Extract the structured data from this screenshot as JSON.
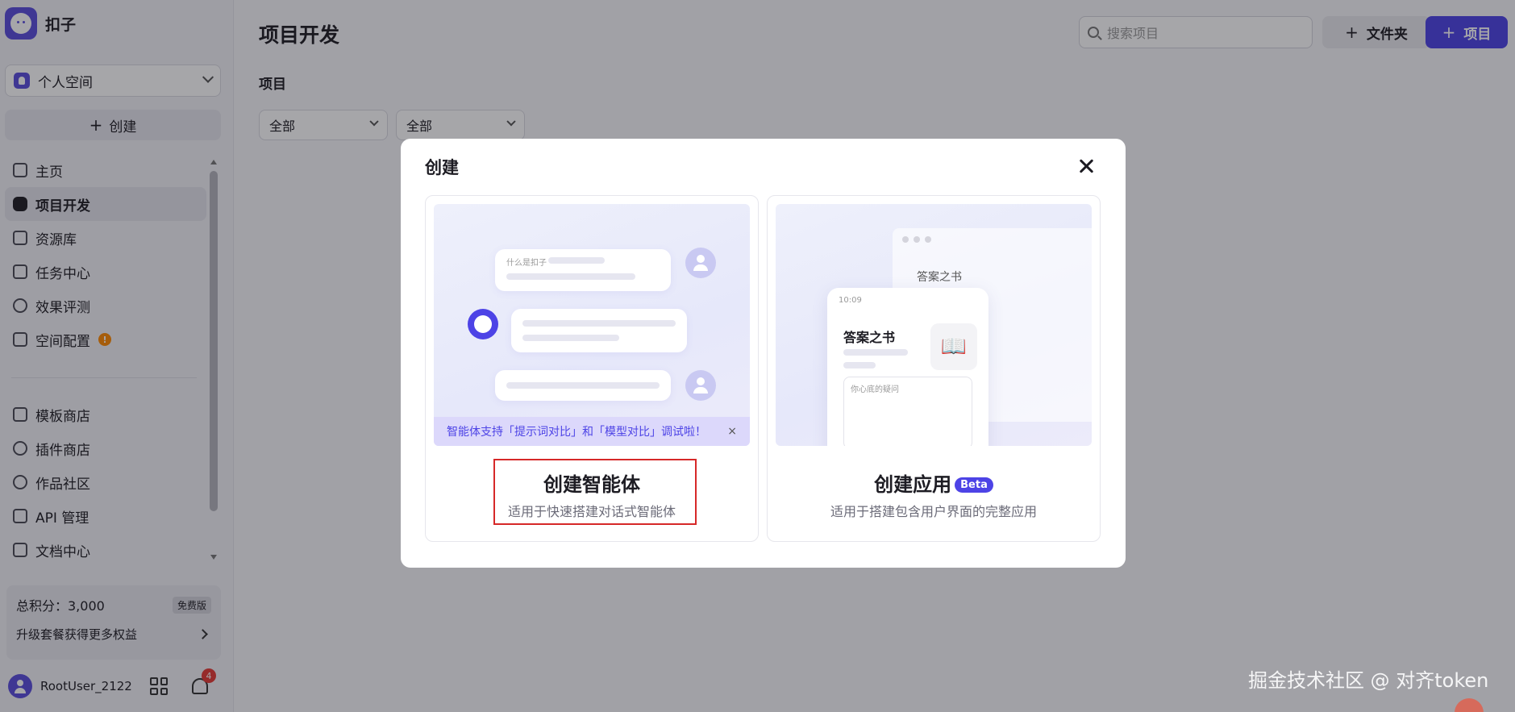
{
  "brand": {
    "name": "扣子"
  },
  "sidebar": {
    "space_label": "个人空间",
    "create_label": "创建",
    "nav": [
      {
        "label": "主页"
      },
      {
        "label": "项目开发"
      },
      {
        "label": "资源库"
      },
      {
        "label": "任务中心"
      },
      {
        "label": "效果评测"
      },
      {
        "label": "空间配置",
        "badge": "!"
      }
    ],
    "nav2": [
      {
        "label": "模板商店"
      },
      {
        "label": "插件商店"
      },
      {
        "label": "作品社区"
      },
      {
        "label": "API 管理"
      },
      {
        "label": "文档中心"
      }
    ],
    "points": {
      "label": "总积分：3,000",
      "plan": "免费版",
      "upgrade": "升级套餐获得更多权益"
    },
    "user": {
      "name": "RootUser_2122",
      "notifications": "4"
    }
  },
  "main": {
    "title": "项目开发",
    "section_label": "项目",
    "filters": [
      "全部",
      "全部"
    ],
    "search_placeholder": "搜索项目",
    "folder_label": "文件夹",
    "project_label": "项目"
  },
  "modal": {
    "title": "创建",
    "options": [
      {
        "title": "创建智能体",
        "desc": "适用于快速搭建对话式智能体",
        "preview_question": "什么是扣子",
        "notice": "智能体支持「提示词对比」和「模型对比」调试啦！",
        "notice_close": "×"
      },
      {
        "title": "创建应用",
        "badge": "Beta",
        "desc": "适用于搭建包含用户界面的完整应用",
        "preview_app_title": "答案之书",
        "preview_time": "10:09",
        "preview_input": "你心底的疑问"
      }
    ]
  },
  "watermark": "掘金技术社区 @ 对齐token"
}
